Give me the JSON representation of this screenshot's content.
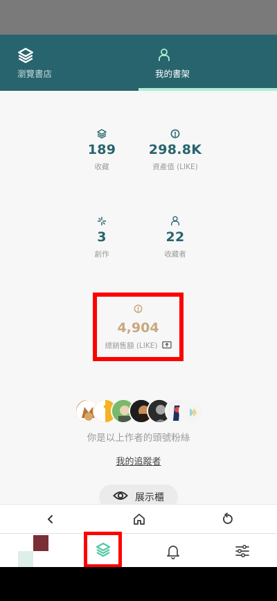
{
  "top_nav": {
    "tabs": [
      {
        "label": "瀏覽書店",
        "icon": "layers-icon",
        "active": false
      },
      {
        "label": "我的書架",
        "icon": "user-icon",
        "active": true
      }
    ]
  },
  "stats": {
    "collected": {
      "value": "189",
      "label": "收藏",
      "icon": "layers-icon"
    },
    "asset_value": {
      "value": "298.8K",
      "label": "資產值 (LIKE)",
      "icon": "like-coin-icon"
    },
    "created": {
      "value": "3",
      "label": "創作",
      "icon": "sparkle-icon"
    },
    "collectors": {
      "value": "22",
      "label": "收藏者",
      "icon": "user-icon"
    },
    "total_sales": {
      "value": "4,904",
      "label": "總銷售額 (LIKE)",
      "icon": "like-coin-icon"
    }
  },
  "fans": {
    "text": "你是以上作者的頭號粉絲",
    "followers_link": "我的追蹤者"
  },
  "showcase": {
    "label": "展示櫃",
    "icon": "eye-icon"
  },
  "browser_bar": {
    "buttons": [
      "back-icon",
      "home-icon",
      "reload-icon"
    ]
  },
  "bottom_nav": {
    "items": [
      "app-logo",
      "layers-icon",
      "bell-icon",
      "settings-sliders-icon"
    ]
  },
  "colors": {
    "primary": "#28646e",
    "accent": "#aaf0d1",
    "sales_gold": "#c9a77e",
    "highlight": "#ff0000"
  }
}
